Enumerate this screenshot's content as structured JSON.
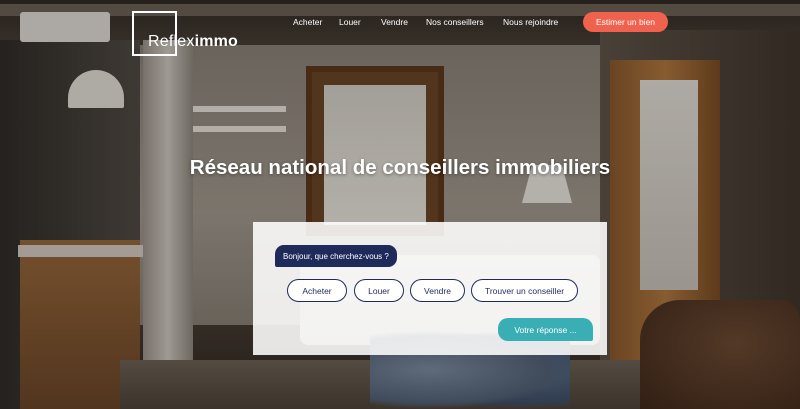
{
  "header": {
    "logo": {
      "part1": "Reflex",
      "part2": "immo"
    },
    "nav": [
      {
        "label": "Acheter"
      },
      {
        "label": "Louer"
      },
      {
        "label": "Vendre"
      },
      {
        "label": "Nos conseillers"
      },
      {
        "label": "Nous rejoindre"
      }
    ],
    "cta_label": "Estimer un bien"
  },
  "hero": {
    "headline": "Réseau national de conseillers immobiliers"
  },
  "chat": {
    "question": "Bonjour, que cherchez-vous ?",
    "choices": [
      {
        "label": "Acheter"
      },
      {
        "label": "Louer"
      },
      {
        "label": "Vendre"
      },
      {
        "label": "Trouver un conseiller"
      }
    ],
    "reply_label": "Votre réponse ..."
  },
  "colors": {
    "accent": "#f0624d",
    "navy": "#1e2b5a",
    "teal": "#3aaeb5"
  }
}
